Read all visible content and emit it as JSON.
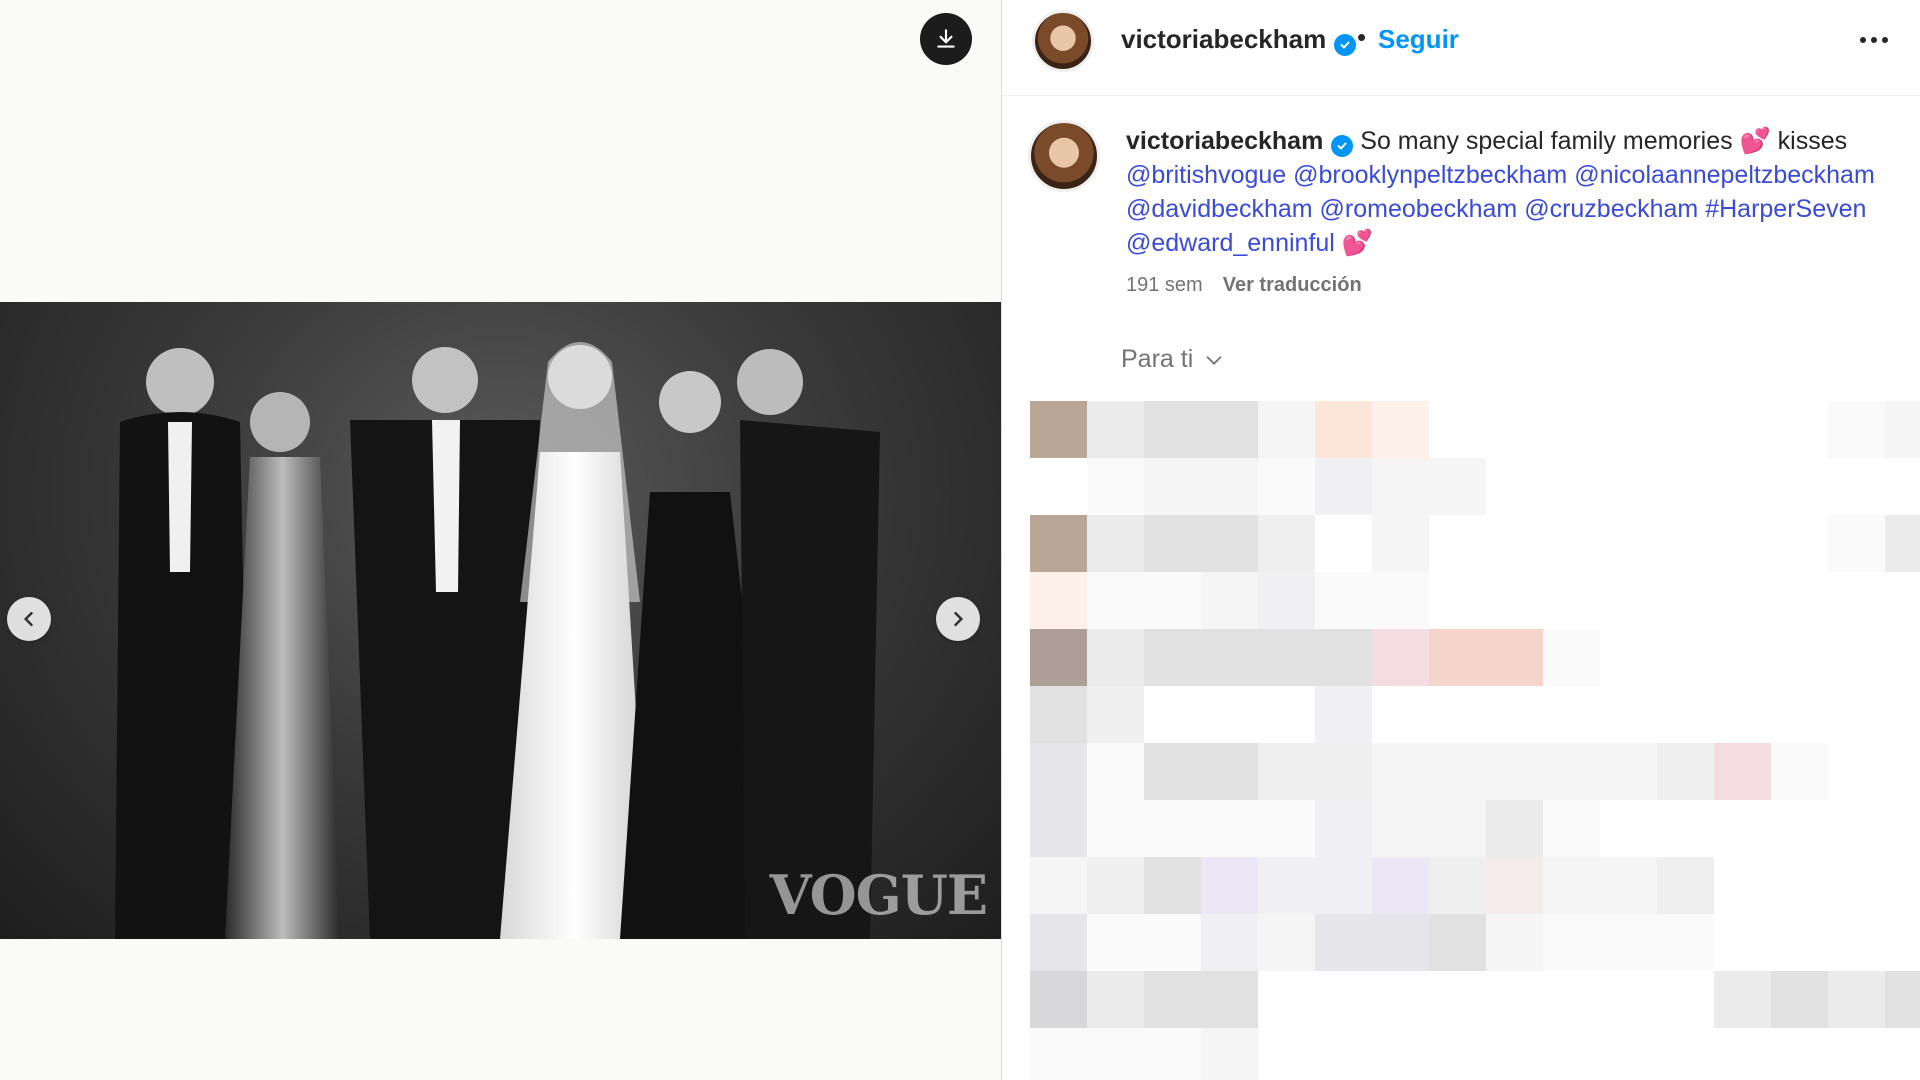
{
  "media": {
    "watermark": "VOGUE",
    "icons": {
      "download": "download-icon",
      "prev": "chevron-left-icon",
      "next": "chevron-right-icon"
    }
  },
  "header": {
    "username": "victoriabeckham",
    "dot": "•",
    "follow_label": "Seguir",
    "more_icon": "more-horizontal-icon"
  },
  "caption": {
    "username": "victoriabeckham",
    "text": "So many special family memories",
    "heart_1": "💕",
    "text_after": "kisses",
    "mentions": [
      "@britishvogue",
      "@brooklynpeltzbeckham",
      "@nicolaannepeltzbeckham",
      "@davidbeckham",
      "@romeobeckham",
      "@cruzbeckham",
      "#HarperSeven",
      "@edward_enninful"
    ],
    "heart_2": "💕"
  },
  "meta": {
    "time": "191 sem",
    "translate_label": "Ver traducción"
  },
  "for_you": {
    "label": "Para ti",
    "icon": "chevron-down-icon"
  },
  "colors": {
    "accent_blue": "#0095f6",
    "mention_blue": "#3a4bd8",
    "muted": "#737373"
  }
}
